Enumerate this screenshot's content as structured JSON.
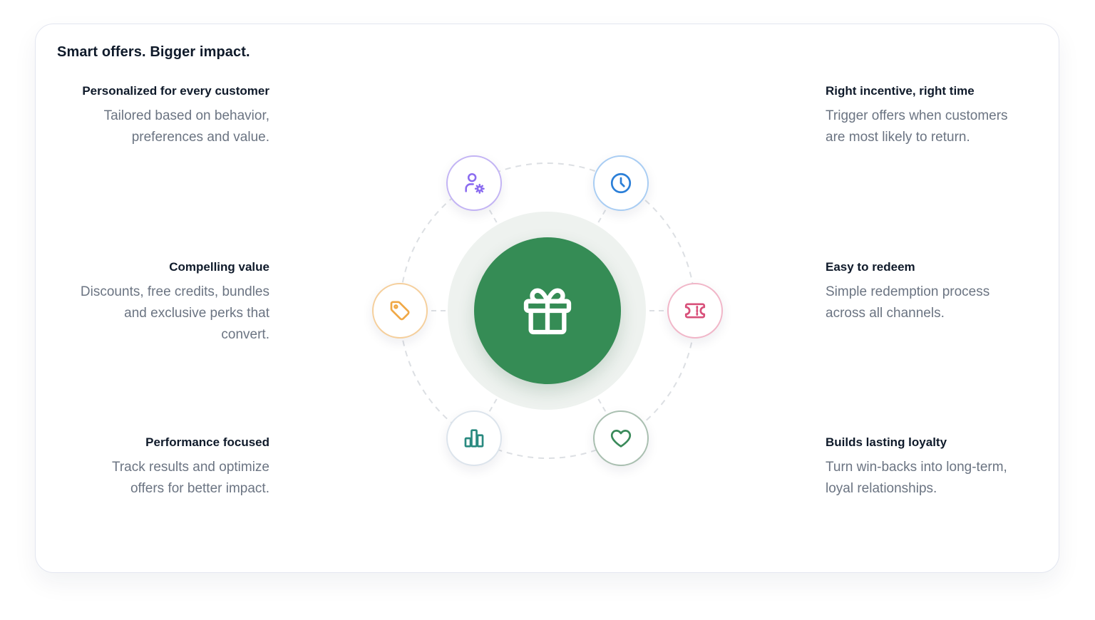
{
  "title": "Smart offers. Bigger impact.",
  "features": {
    "personalized": {
      "title": "Personalized for every customer",
      "desc_lines": [
        "Tailored based on behavior,",
        "preferences and value."
      ],
      "icon": "user-gear-icon",
      "color": "#8b6cf0"
    },
    "compelling": {
      "title": "Compelling value",
      "desc_lines": [
        "Discounts, free credits, bundles",
        "and exclusive perks that",
        "convert."
      ],
      "icon": "tag-icon",
      "color": "#f0a846"
    },
    "performance": {
      "title": "Performance focused",
      "desc_lines": [
        "Track results and optimize",
        "offers for better impact."
      ],
      "icon": "bar-chart-icon",
      "color": "#2a8a80"
    },
    "timing": {
      "title": "Right incentive, right time",
      "desc_lines": [
        "Trigger offers when customers",
        "are most likely to return."
      ],
      "icon": "clock-icon",
      "color": "#2b7fd8"
    },
    "redeem": {
      "title": "Easy to redeem",
      "desc_lines": [
        "Simple redemption process",
        "across all channels."
      ],
      "icon": "ticket-icon",
      "color": "#d8507a"
    },
    "loyalty": {
      "title": "Builds lasting loyalty",
      "desc_lines": [
        "Turn win-backs into long-term,",
        "loyal relationships."
      ],
      "icon": "heart-icon",
      "color": "#3a8a5a"
    }
  },
  "hub": {
    "icon": "gift-icon",
    "color": "#358c55"
  }
}
